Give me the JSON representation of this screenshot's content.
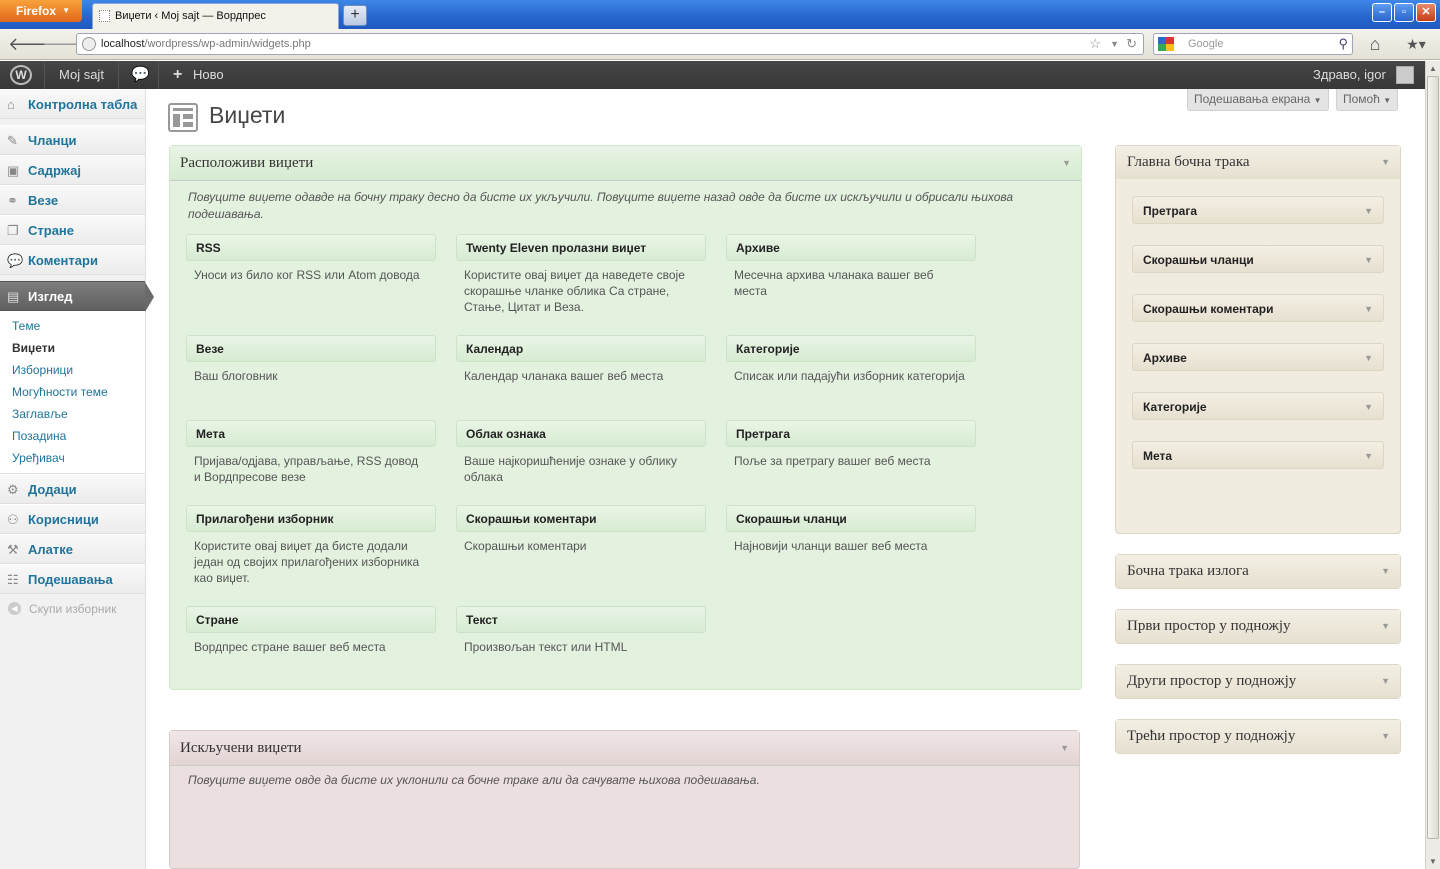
{
  "browser": {
    "menu_button": "Firefox",
    "tab_title": "Виџети ‹ Мој sajt — Вордпрес",
    "url_host": "localhost",
    "url_path": "/wordpress/wp-admin/widgets.php",
    "search_placeholder": "Google"
  },
  "adminbar": {
    "site_name": "Мој sajt",
    "new_label": "Ново",
    "greeting": "Здраво, igor"
  },
  "menu": {
    "dashboard": "Контролна табла",
    "posts": "Чланци",
    "media": "Садржај",
    "links": "Везе",
    "pages": "Стране",
    "comments": "Коментари",
    "appearance": "Изглед",
    "appearance_sub": [
      "Теме",
      "Виџети",
      "Изборници",
      "Могућности теме",
      "Заглавље",
      "Позадина",
      "Уређивач"
    ],
    "plugins": "Додаци",
    "users": "Корисници",
    "tools": "Алатке",
    "settings": "Подешавања",
    "collapse": "Скупи изборник"
  },
  "header": {
    "screen_options": "Подешавања екрана",
    "help": "Помоћ",
    "title": "Виџети"
  },
  "available": {
    "title": "Расположиви виџети",
    "description": "Повуците виџете одавде на бочну траку десно да бисте их укључили. Повуците виџете назад овде да бисте их искључили и обрисали њихова подешавања.",
    "widgets": [
      {
        "title": "RSS",
        "desc": "Уноси из било ког RSS или Atom довода"
      },
      {
        "title": "Twenty Eleven пролазни виџет",
        "desc": "Користите овај виџет да наведете своје скорашње чланке облика Са стране, Стање, Цитат и Веза."
      },
      {
        "title": "Архиве",
        "desc": "Месечна архива чланака вашег веб места"
      },
      {
        "title": "Везе",
        "desc": "Ваш блоговник"
      },
      {
        "title": "Календар",
        "desc": "Календар чланака вашег веб места"
      },
      {
        "title": "Категорије",
        "desc": "Списак или падајући изборник категорија"
      },
      {
        "title": "Мета",
        "desc": "Пријава/одјава, управљање, RSS довод и Вордпресове везе"
      },
      {
        "title": "Облак ознака",
        "desc": "Ваше најкоришћеније ознаке у облику облака"
      },
      {
        "title": "Претрага",
        "desc": "Поље за претрагу вашег веб места"
      },
      {
        "title": "Прилагођени изборник",
        "desc": "Користите овај виџет да бисте додали један од својих прилагођених изборника као виџет."
      },
      {
        "title": "Скорашњи коментари",
        "desc": "Скорашњи коментари"
      },
      {
        "title": "Скорашњи чланци",
        "desc": "Најновији чланци вашег веб места"
      },
      {
        "title": "Стране",
        "desc": "Вордпрес стране вашег веб места"
      },
      {
        "title": "Текст",
        "desc": "Произвољан текст или HTML"
      }
    ]
  },
  "inactive": {
    "title": "Искључени виџети",
    "description": "Повуците виџете овде да бисте их уклонили са бочне траке али да сачувате њихова подешавања."
  },
  "sidebars": {
    "main": {
      "title": "Главна бочна трака",
      "widgets": [
        "Претрага",
        "Скорашњи чланци",
        "Скорашњи коментари",
        "Архиве",
        "Категорије",
        "Мета"
      ]
    },
    "showcase": "Бочна трака излога",
    "footer1": "Први простор у подножју",
    "footer2": "Други простор у подножју",
    "footer3": "Трећи простор у подножју"
  }
}
